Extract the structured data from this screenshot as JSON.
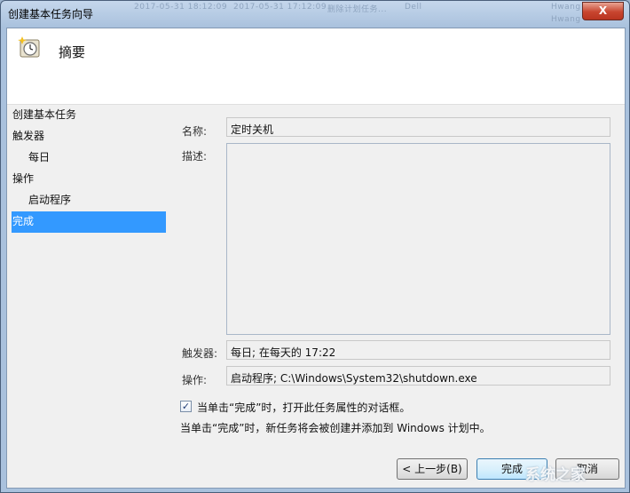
{
  "window": {
    "title": "创建基本任务向导",
    "close_label": "X"
  },
  "background_ghost": [
    "2017-05-31 18:12:09",
    "2017-05-31 17:12:09",
    "删除计划任务...",
    "Dell",
    "Hwang",
    "Hwang"
  ],
  "header": {
    "title": "摘要",
    "icon": "task-clock-icon"
  },
  "sidebar": {
    "items": [
      {
        "label": "创建基本任务",
        "active": false,
        "sub": false
      },
      {
        "label": "触发器",
        "active": false,
        "sub": false
      },
      {
        "label": "每日",
        "active": false,
        "sub": true
      },
      {
        "label": "操作",
        "active": false,
        "sub": false
      },
      {
        "label": "启动程序",
        "active": false,
        "sub": true
      },
      {
        "label": "完成",
        "active": true,
        "sub": false
      }
    ]
  },
  "form": {
    "name_label": "名称:",
    "name_value": "定时关机",
    "desc_label": "描述:",
    "desc_value": "",
    "trigger_label": "触发器:",
    "trigger_value": "每日; 在每天的 17:22",
    "action_label": "操作:",
    "action_value": "启动程序; C:\\Windows\\System32\\shutdown.exe"
  },
  "checkbox": {
    "checked": true,
    "label": "当单击“完成”时，打开此任务属性的对话框。"
  },
  "note": "当单击“完成”时，新任务将会被创建并添加到 Windows 计划中。",
  "buttons": {
    "back": "< 上一步(B)",
    "finish": "完成",
    "cancel": "取消"
  },
  "watermark": "系统之家"
}
